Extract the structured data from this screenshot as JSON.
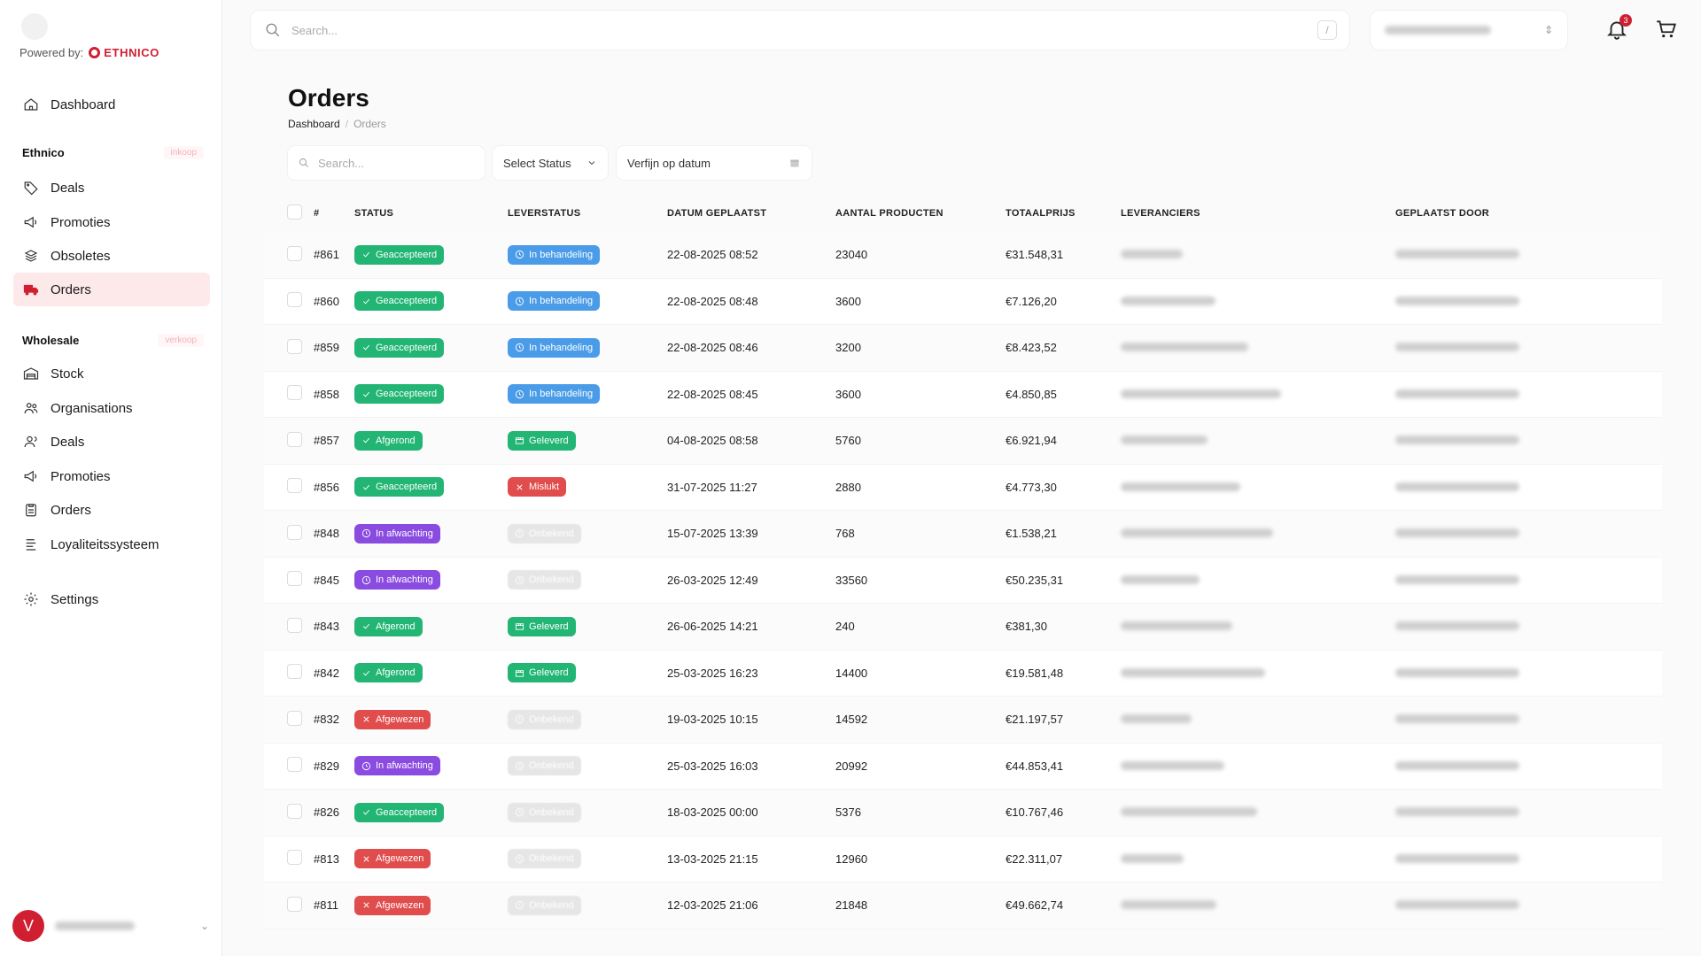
{
  "sidebar": {
    "powered_label": "Powered by:",
    "brand_name": "ETHNICO",
    "dashboard": "Dashboard",
    "section_inkoop": {
      "title": "Ethnico",
      "tag": "inkoop"
    },
    "inkoop_items": [
      "Deals",
      "Promoties",
      "Obsoletes",
      "Orders"
    ],
    "section_verkoop": {
      "title": "Wholesale",
      "tag": "verkoop"
    },
    "verkoop_items": [
      "Stock",
      "Organisations",
      "Deals",
      "Promoties",
      "Orders",
      "Loyaliteitssysteem"
    ],
    "settings": "Settings",
    "user_initial": "V"
  },
  "topbar": {
    "search_placeholder": "Search...",
    "shortcut": "/",
    "notification_count": "3"
  },
  "page": {
    "title": "Orders",
    "breadcrumb_home": "Dashboard",
    "breadcrumb_sep": "/",
    "breadcrumb_current": "Orders"
  },
  "filters": {
    "search_placeholder": "Search...",
    "status_label": "Select Status",
    "date_label": "Verfijn op datum"
  },
  "table": {
    "headers": [
      "#",
      "STATUS",
      "LEVERSTATUS",
      "DATUM GEPLAATST",
      "AANTAL PRODUCTEN",
      "TOTAALPRIJS",
      "LEVERANCIERS",
      "GEPLAATST DOOR"
    ],
    "rows": [
      {
        "id": "#861",
        "status": "Geaccepteerd",
        "status_type": "green-check",
        "lever": "In behandeling",
        "lever_type": "blue-clock",
        "datum": "22-08-2025 08:52",
        "aantal": "23040",
        "prijs": "€31.548,31"
      },
      {
        "id": "#860",
        "status": "Geaccepteerd",
        "status_type": "green-check",
        "lever": "In behandeling",
        "lever_type": "blue-clock",
        "datum": "22-08-2025 08:48",
        "aantal": "3600",
        "prijs": "€7.126,20"
      },
      {
        "id": "#859",
        "status": "Geaccepteerd",
        "status_type": "green-check",
        "lever": "In behandeling",
        "lever_type": "blue-clock",
        "datum": "22-08-2025 08:46",
        "aantal": "3200",
        "prijs": "€8.423,52"
      },
      {
        "id": "#858",
        "status": "Geaccepteerd",
        "status_type": "green-check",
        "lever": "In behandeling",
        "lever_type": "blue-clock",
        "datum": "22-08-2025 08:45",
        "aantal": "3600",
        "prijs": "€4.850,85"
      },
      {
        "id": "#857",
        "status": "Afgerond",
        "status_type": "green-check",
        "lever": "Geleverd",
        "lever_type": "green-box",
        "datum": "04-08-2025 08:58",
        "aantal": "5760",
        "prijs": "€6.921,94"
      },
      {
        "id": "#856",
        "status": "Geaccepteerd",
        "status_type": "green-check",
        "lever": "Mislukt",
        "lever_type": "red-x",
        "datum": "31-07-2025 11:27",
        "aantal": "2880",
        "prijs": "€4.773,30"
      },
      {
        "id": "#848",
        "status": "In afwachting",
        "status_type": "purple-clock",
        "lever": "Onbekend",
        "lever_type": "grey",
        "datum": "15-07-2025 13:39",
        "aantal": "768",
        "prijs": "€1.538,21"
      },
      {
        "id": "#845",
        "status": "In afwachting",
        "status_type": "purple-clock",
        "lever": "Onbekend",
        "lever_type": "grey",
        "datum": "26-03-2025 12:49",
        "aantal": "33560",
        "prijs": "€50.235,31"
      },
      {
        "id": "#843",
        "status": "Afgerond",
        "status_type": "green-check",
        "lever": "Geleverd",
        "lever_type": "green-box",
        "datum": "26-06-2025 14:21",
        "aantal": "240",
        "prijs": "€381,30"
      },
      {
        "id": "#842",
        "status": "Afgerond",
        "status_type": "green-check",
        "lever": "Geleverd",
        "lever_type": "green-box",
        "datum": "25-03-2025 16:23",
        "aantal": "14400",
        "prijs": "€19.581,48"
      },
      {
        "id": "#832",
        "status": "Afgewezen",
        "status_type": "red-x",
        "lever": "Onbekend",
        "lever_type": "grey",
        "datum": "19-03-2025 10:15",
        "aantal": "14592",
        "prijs": "€21.197,57"
      },
      {
        "id": "#829",
        "status": "In afwachting",
        "status_type": "purple-clock",
        "lever": "Onbekend",
        "lever_type": "grey",
        "datum": "25-03-2025 16:03",
        "aantal": "20992",
        "prijs": "€44.853,41"
      },
      {
        "id": "#826",
        "status": "Geaccepteerd",
        "status_type": "green-check",
        "lever": "Onbekend",
        "lever_type": "grey",
        "datum": "18-03-2025 00:00",
        "aantal": "5376",
        "prijs": "€10.767,46"
      },
      {
        "id": "#813",
        "status": "Afgewezen",
        "status_type": "red-x",
        "lever": "Onbekend",
        "lever_type": "grey",
        "datum": "13-03-2025 21:15",
        "aantal": "12960",
        "prijs": "€22.311,07"
      },
      {
        "id": "#811",
        "status": "Afgewezen",
        "status_type": "red-x",
        "lever": "Onbekend",
        "lever_type": "grey",
        "datum": "12-03-2025 21:06",
        "aantal": "21848",
        "prijs": "€49.662,74"
      }
    ]
  },
  "colors": {
    "brand": "#d11f32",
    "green": "#22b573",
    "blue": "#4a9ce8",
    "purple": "#8a4be0",
    "red": "#e14c4c"
  }
}
